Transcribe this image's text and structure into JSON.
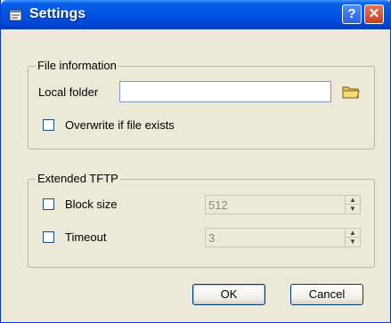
{
  "window": {
    "title": "Settings"
  },
  "titlebar": {
    "help_label": "?",
    "close_label": "✕"
  },
  "file_information": {
    "legend": "File information",
    "local_folder_label": "Local folder",
    "local_folder_value": "",
    "overwrite_label": "Overwrite if file exists",
    "overwrite_checked": false
  },
  "extended_tftp": {
    "legend": "Extended TFTP",
    "block_size_label": "Block size",
    "block_size_value": "512",
    "block_size_checked": false,
    "timeout_label": "Timeout",
    "timeout_value": "3",
    "timeout_checked": false
  },
  "buttons": {
    "ok_label": "OK",
    "cancel_label": "Cancel"
  }
}
